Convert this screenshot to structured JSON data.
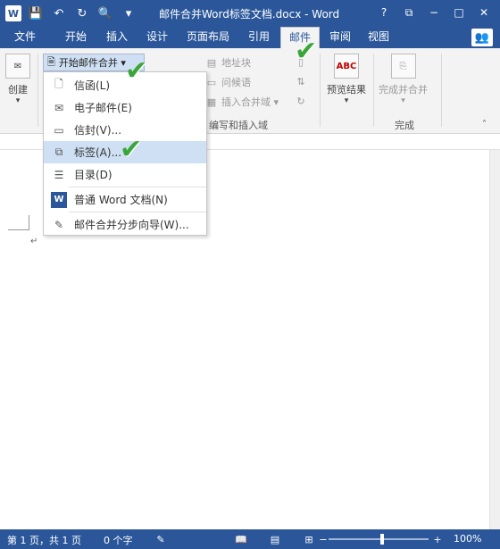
{
  "titlebar": {
    "doc_title": "邮件合并Word标签文档.docx - Word",
    "app_icon": "W",
    "qat_icons": [
      "save-icon",
      "undo-icon",
      "redo-icon",
      "print-preview-icon"
    ],
    "window_controls": [
      "?",
      "restore",
      "minimize",
      "maximize",
      "close"
    ]
  },
  "tabs": [
    "文件",
    "开始",
    "插入",
    "设计",
    "页面布局",
    "引用",
    "邮件",
    "审阅",
    "视图"
  ],
  "active_tab": "邮件",
  "ribbon": {
    "create_label": "创建",
    "start_mail_merge": "开始邮件合并 ▾",
    "address_block": "地址块",
    "greeting_line": "问候语",
    "insert_merge_field": "插入合并域 ▾",
    "write_insert_group": "编写和插入域",
    "preview_results": "预览结果",
    "preview_abc": "ABC",
    "finish_merge": "完成并合并",
    "finish_group": "完成"
  },
  "menu": {
    "items": [
      {
        "label": "信函(L)",
        "icon": "letter-icon"
      },
      {
        "label": "电子邮件(E)",
        "icon": "email-icon"
      },
      {
        "label": "信封(V)...",
        "icon": "envelope-icon"
      },
      {
        "label": "标签(A)...",
        "icon": "labels-icon"
      },
      {
        "label": "目录(D)",
        "icon": "directory-icon"
      },
      {
        "label": "普通 Word 文档(N)",
        "icon": "word-doc-icon"
      },
      {
        "label": "邮件合并分步向导(W)...",
        "icon": "wizard-icon"
      }
    ],
    "highlighted": "标签(A)..."
  },
  "statusbar": {
    "page": "第 1 页，共 1 页",
    "words": "0 个字",
    "zoom": "100%",
    "zoom_minus": "−",
    "zoom_plus": "+"
  },
  "colors": {
    "word_blue": "#2b579a",
    "check_green": "#3aa63a",
    "menu_highlight": "#cfe0f4"
  }
}
